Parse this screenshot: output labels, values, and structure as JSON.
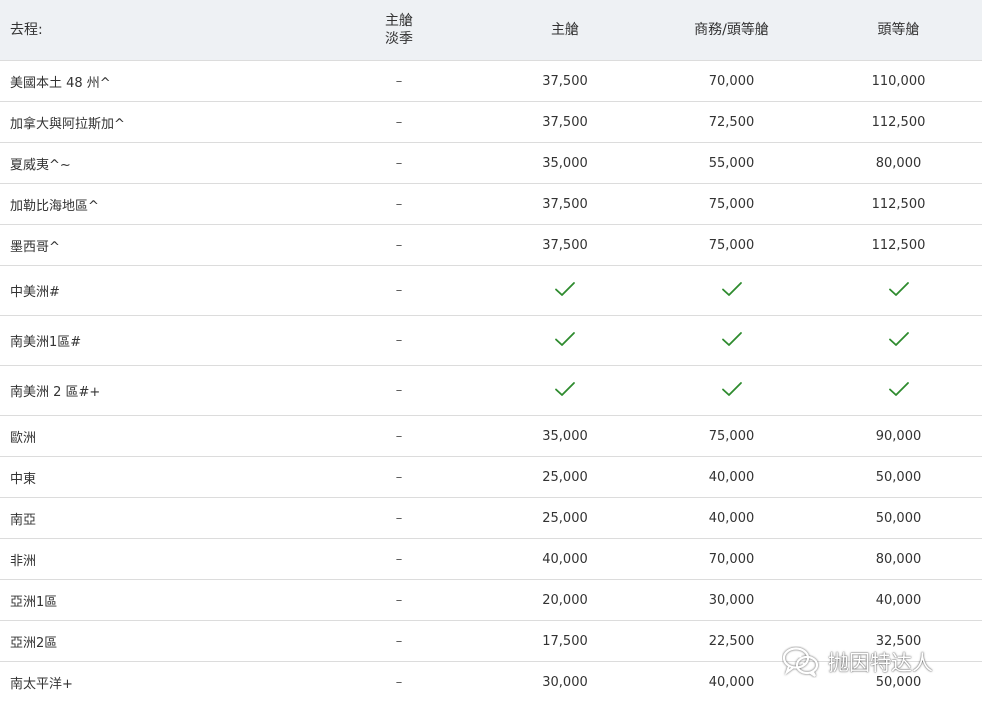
{
  "headers": {
    "destination": "去程:",
    "saver_line1": "主艙",
    "saver_line2": "淡季",
    "main": "主艙",
    "business": "商務/頭等艙",
    "first": "頭等艙"
  },
  "rows": [
    {
      "name": "美國本土 48 州^",
      "saver": "–",
      "main": "37,500",
      "business": "70,000",
      "first": "110,000"
    },
    {
      "name": "加拿大與阿拉斯加^",
      "saver": "–",
      "main": "37,500",
      "business": "72,500",
      "first": "112,500"
    },
    {
      "name": "夏威夷^~",
      "saver": "–",
      "main": "35,000",
      "business": "55,000",
      "first": "80,000"
    },
    {
      "name": "加勒比海地區^",
      "saver": "–",
      "main": "37,500",
      "business": "75,000",
      "first": "112,500"
    },
    {
      "name": "墨西哥^",
      "saver": "–",
      "main": "37,500",
      "business": "75,000",
      "first": "112,500"
    },
    {
      "name": "中美洲#",
      "saver": "–",
      "main": "check",
      "business": "check",
      "first": "check"
    },
    {
      "name": "南美洲1區#",
      "saver": "–",
      "main": "check",
      "business": "check",
      "first": "check"
    },
    {
      "name": "南美洲 2 區#+",
      "saver": "–",
      "main": "check",
      "business": "check",
      "first": "check"
    },
    {
      "name": "歐洲",
      "saver": "–",
      "main": "35,000",
      "business": "75,000",
      "first": "90,000"
    },
    {
      "name": "中東",
      "saver": "–",
      "main": "25,000",
      "business": "40,000",
      "first": "50,000"
    },
    {
      "name": "南亞",
      "saver": "–",
      "main": "25,000",
      "business": "40,000",
      "first": "50,000"
    },
    {
      "name": "非洲",
      "saver": "–",
      "main": "40,000",
      "business": "70,000",
      "first": "80,000"
    },
    {
      "name": "亞洲1區",
      "saver": "–",
      "main": "20,000",
      "business": "30,000",
      "first": "40,000"
    },
    {
      "name": "亞洲2區",
      "saver": "–",
      "main": "17,500",
      "business": "22,500",
      "first": "32,500"
    },
    {
      "name": "南太平洋+",
      "saver": "–",
      "main": "30,000",
      "business": "40,000",
      "first": "50,000"
    }
  ],
  "check_color": "#2e8b2e",
  "watermark": {
    "text": "抛因特达人",
    "icon": "wechat-icon"
  }
}
